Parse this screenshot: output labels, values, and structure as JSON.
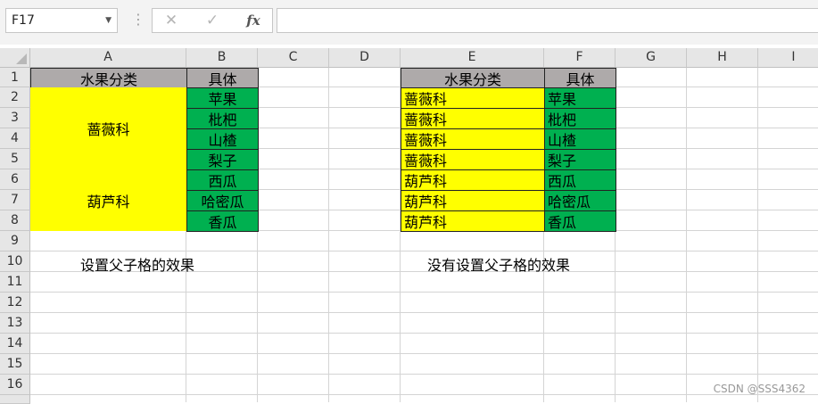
{
  "formula_bar": {
    "name_box": "F17",
    "cancel_icon": "✕",
    "enter_icon": "✓",
    "fx_label": "fx",
    "formula_value": ""
  },
  "columns": [
    "A",
    "B",
    "C",
    "D",
    "E",
    "F",
    "G",
    "H",
    "I"
  ],
  "rows": [
    "1",
    "2",
    "3",
    "4",
    "5",
    "6",
    "7",
    "8",
    "9",
    "10",
    "11",
    "12",
    "13",
    "14",
    "15",
    "16"
  ],
  "table1": {
    "header": [
      "水果分类",
      "具体"
    ],
    "groups": [
      {
        "category": "蔷薇科",
        "items": [
          "苹果",
          "枇杷",
          "山楂",
          "梨子"
        ]
      },
      {
        "category": "葫芦科",
        "items": [
          "西瓜",
          "哈密瓜",
          "香瓜"
        ]
      }
    ],
    "caption": "设置父子格的效果"
  },
  "table2": {
    "header": [
      "水果分类",
      "具体"
    ],
    "rows": [
      [
        "蔷薇科",
        "苹果"
      ],
      [
        "蔷薇科",
        "枇杷"
      ],
      [
        "蔷薇科",
        "山楂"
      ],
      [
        "蔷薇科",
        "梨子"
      ],
      [
        "葫芦科",
        "西瓜"
      ],
      [
        "葫芦科",
        "哈密瓜"
      ],
      [
        "葫芦科",
        "香瓜"
      ]
    ],
    "caption": "没有设置父子格的效果"
  },
  "watermark": "CSDN @SSS4362",
  "colors": {
    "header_gray": "#aeaaaa",
    "category_yellow": "#ffff00",
    "item_green": "#00b050"
  }
}
